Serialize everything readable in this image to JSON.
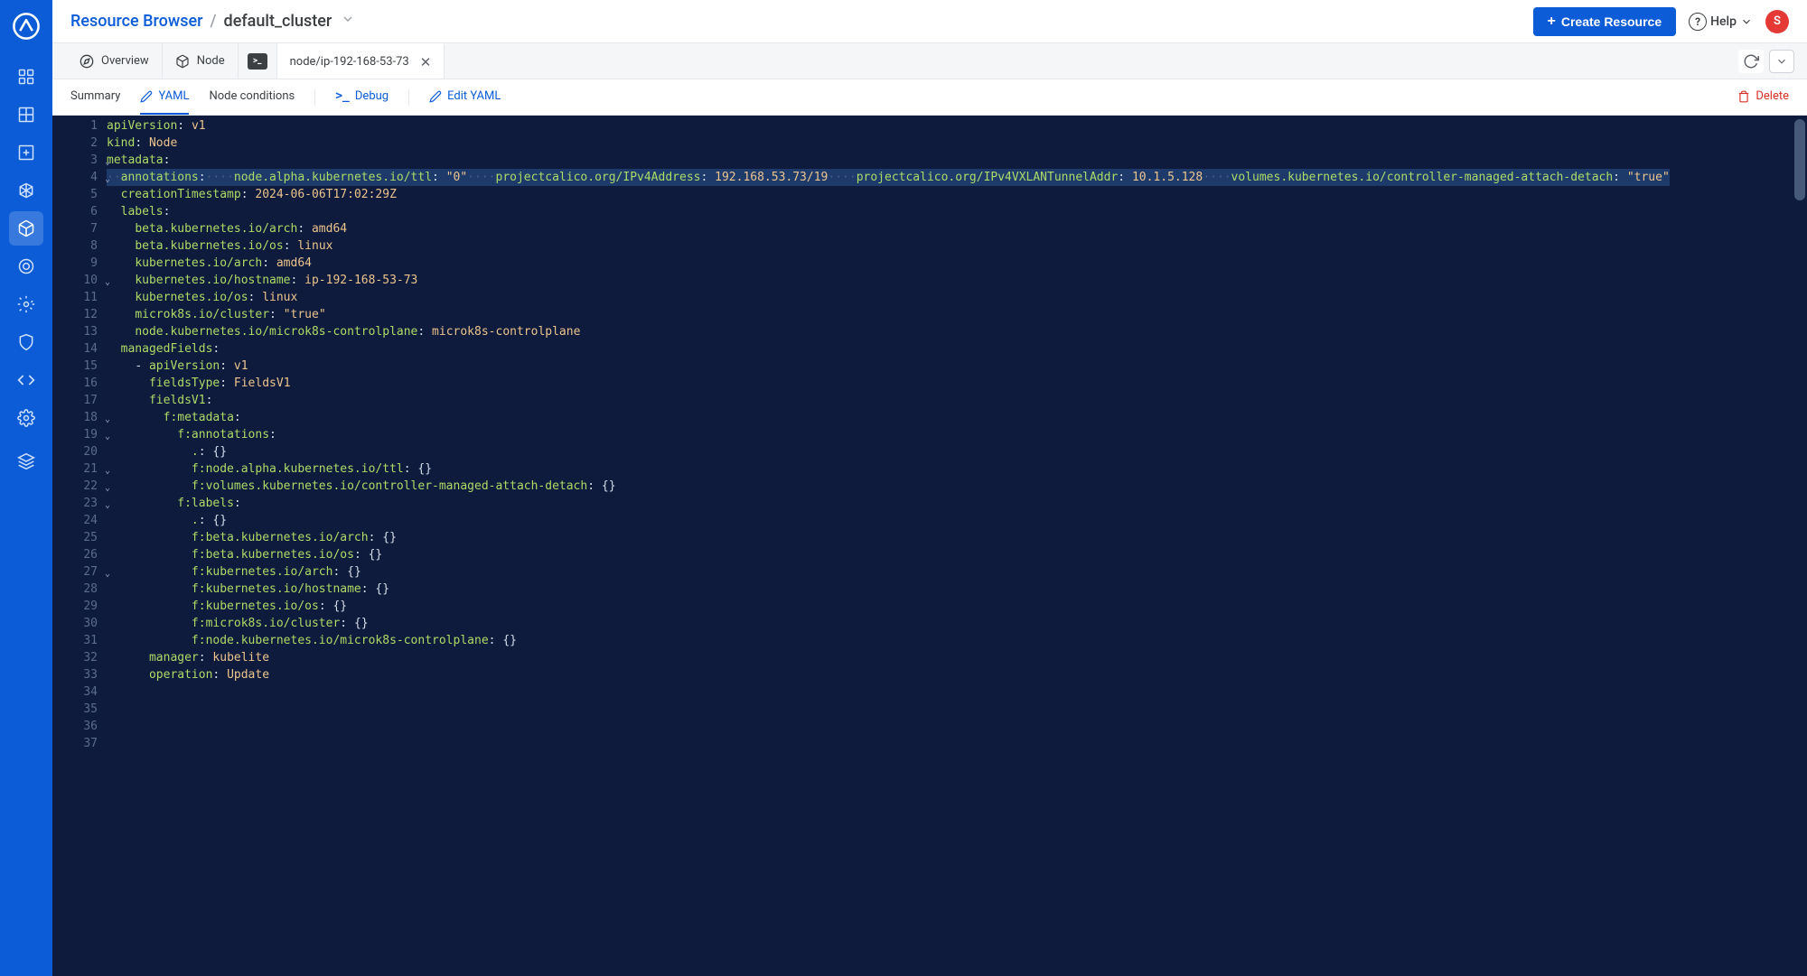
{
  "header": {
    "breadcrumb_root": "Resource Browser",
    "breadcrumb_current": "default_cluster",
    "create_button": "Create Resource",
    "help_label": "Help",
    "avatar_initial": "S"
  },
  "tabs": {
    "overview": "Overview",
    "node": "Node",
    "active": "node/ip-192-168-53-73"
  },
  "subtabs": {
    "summary": "Summary",
    "yaml": "YAML",
    "node_conditions": "Node conditions",
    "debug": "Debug",
    "edit_yaml": "Edit YAML",
    "delete": "Delete"
  },
  "yaml": {
    "lines": [
      {
        "n": 1,
        "fold": "",
        "sel": false,
        "tokens": [
          [
            "key",
            "apiVersion"
          ],
          [
            "punc",
            ": "
          ],
          [
            "val",
            "v1"
          ]
        ]
      },
      {
        "n": 2,
        "fold": "",
        "sel": false,
        "tokens": [
          [
            "key",
            "kind"
          ],
          [
            "punc",
            ": "
          ],
          [
            "val",
            "Node"
          ]
        ]
      },
      {
        "n": 3,
        "fold": "v",
        "sel": false,
        "tokens": [
          [
            "key",
            "metadata"
          ],
          [
            "punc",
            ":"
          ]
        ]
      },
      {
        "n": 4,
        "fold": "v",
        "sel": true,
        "indent": "  ",
        "tokens": [
          [
            "key",
            "annotations"
          ],
          [
            "punc",
            ":"
          ]
        ]
      },
      {
        "n": 5,
        "fold": "",
        "sel": true,
        "indent": "    ",
        "tokens": [
          [
            "key",
            "node.alpha.kubernetes.io/ttl"
          ],
          [
            "punc",
            ": "
          ],
          [
            "str",
            "\"0\""
          ]
        ]
      },
      {
        "n": 6,
        "fold": "",
        "sel": true,
        "indent": "    ",
        "tokens": [
          [
            "key",
            "projectcalico.org/IPv4Address"
          ],
          [
            "punc",
            ": "
          ],
          [
            "val",
            "192.168.53.73/19"
          ]
        ]
      },
      {
        "n": 7,
        "fold": "",
        "sel": true,
        "indent": "    ",
        "tokens": [
          [
            "key",
            "projectcalico.org/IPv4VXLANTunnelAddr"
          ],
          [
            "punc",
            ": "
          ],
          [
            "val",
            "10.1.5.128"
          ]
        ]
      },
      {
        "n": 8,
        "fold": "",
        "sel": true,
        "indent": "    ",
        "tokens": [
          [
            "key",
            "volumes.kubernetes.io/controller-managed-attach-detach"
          ],
          [
            "punc",
            ": "
          ],
          [
            "str",
            "\"true\""
          ]
        ]
      },
      {
        "n": 9,
        "fold": "",
        "sel": false,
        "indent": "  ",
        "tokens": [
          [
            "key",
            "creationTimestamp"
          ],
          [
            "punc",
            ": "
          ],
          [
            "val",
            "2024-06-06T17:02:29Z"
          ]
        ]
      },
      {
        "n": 10,
        "fold": "v",
        "sel": false,
        "indent": "  ",
        "tokens": [
          [
            "key",
            "labels"
          ],
          [
            "punc",
            ":"
          ]
        ]
      },
      {
        "n": 11,
        "fold": "",
        "sel": false,
        "indent": "    ",
        "tokens": [
          [
            "key",
            "beta.kubernetes.io/arch"
          ],
          [
            "punc",
            ": "
          ],
          [
            "val",
            "amd64"
          ]
        ]
      },
      {
        "n": 12,
        "fold": "",
        "sel": false,
        "indent": "    ",
        "tokens": [
          [
            "key",
            "beta.kubernetes.io/os"
          ],
          [
            "punc",
            ": "
          ],
          [
            "val",
            "linux"
          ]
        ]
      },
      {
        "n": 13,
        "fold": "",
        "sel": false,
        "indent": "    ",
        "tokens": [
          [
            "key",
            "kubernetes.io/arch"
          ],
          [
            "punc",
            ": "
          ],
          [
            "val",
            "amd64"
          ]
        ]
      },
      {
        "n": 14,
        "fold": "",
        "sel": false,
        "indent": "    ",
        "tokens": [
          [
            "key",
            "kubernetes.io/hostname"
          ],
          [
            "punc",
            ": "
          ],
          [
            "val",
            "ip-192-168-53-73"
          ]
        ]
      },
      {
        "n": 15,
        "fold": "",
        "sel": false,
        "indent": "    ",
        "tokens": [
          [
            "key",
            "kubernetes.io/os"
          ],
          [
            "punc",
            ": "
          ],
          [
            "val",
            "linux"
          ]
        ]
      },
      {
        "n": 16,
        "fold": "",
        "sel": false,
        "indent": "    ",
        "tokens": [
          [
            "key",
            "microk8s.io/cluster"
          ],
          [
            "punc",
            ": "
          ],
          [
            "str",
            "\"true\""
          ]
        ]
      },
      {
        "n": 17,
        "fold": "",
        "sel": false,
        "indent": "    ",
        "tokens": [
          [
            "key",
            "node.kubernetes.io/microk8s-controlplane"
          ],
          [
            "punc",
            ": "
          ],
          [
            "val",
            "microk8s-controlplane"
          ]
        ]
      },
      {
        "n": 18,
        "fold": "v",
        "sel": false,
        "indent": "  ",
        "tokens": [
          [
            "key",
            "managedFields"
          ],
          [
            "punc",
            ":"
          ]
        ]
      },
      {
        "n": 19,
        "fold": "v",
        "sel": false,
        "indent": "    ",
        "tokens": [
          [
            "punc",
            "- "
          ],
          [
            "key",
            "apiVersion"
          ],
          [
            "punc",
            ": "
          ],
          [
            "val",
            "v1"
          ]
        ]
      },
      {
        "n": 20,
        "fold": "",
        "sel": false,
        "indent": "      ",
        "tokens": [
          [
            "key",
            "fieldsType"
          ],
          [
            "punc",
            ": "
          ],
          [
            "val",
            "FieldsV1"
          ]
        ]
      },
      {
        "n": 21,
        "fold": "v",
        "sel": false,
        "indent": "      ",
        "tokens": [
          [
            "key",
            "fieldsV1"
          ],
          [
            "punc",
            ":"
          ]
        ]
      },
      {
        "n": 22,
        "fold": "v",
        "sel": false,
        "indent": "        ",
        "tokens": [
          [
            "key",
            "f:metadata"
          ],
          [
            "punc",
            ":"
          ]
        ]
      },
      {
        "n": 23,
        "fold": "v",
        "sel": false,
        "indent": "          ",
        "tokens": [
          [
            "key",
            "f:annotations"
          ],
          [
            "punc",
            ":"
          ]
        ]
      },
      {
        "n": 24,
        "fold": "",
        "sel": false,
        "indent": "            ",
        "tokens": [
          [
            "key",
            "."
          ],
          [
            "punc",
            ": "
          ],
          [
            "punc",
            "{}"
          ]
        ]
      },
      {
        "n": 25,
        "fold": "",
        "sel": false,
        "indent": "            ",
        "tokens": [
          [
            "key",
            "f:node.alpha.kubernetes.io/ttl"
          ],
          [
            "punc",
            ": "
          ],
          [
            "punc",
            "{}"
          ]
        ]
      },
      {
        "n": 26,
        "fold": "",
        "sel": false,
        "indent": "            ",
        "tokens": [
          [
            "key",
            "f:volumes.kubernetes.io/controller-managed-attach-detach"
          ],
          [
            "punc",
            ": "
          ],
          [
            "punc",
            "{}"
          ]
        ]
      },
      {
        "n": 27,
        "fold": "v",
        "sel": false,
        "indent": "          ",
        "tokens": [
          [
            "key",
            "f:labels"
          ],
          [
            "punc",
            ":"
          ]
        ]
      },
      {
        "n": 28,
        "fold": "",
        "sel": false,
        "indent": "            ",
        "tokens": [
          [
            "key",
            "."
          ],
          [
            "punc",
            ": "
          ],
          [
            "punc",
            "{}"
          ]
        ]
      },
      {
        "n": 29,
        "fold": "",
        "sel": false,
        "indent": "            ",
        "tokens": [
          [
            "key",
            "f:beta.kubernetes.io/arch"
          ],
          [
            "punc",
            ": "
          ],
          [
            "punc",
            "{}"
          ]
        ]
      },
      {
        "n": 30,
        "fold": "",
        "sel": false,
        "indent": "            ",
        "tokens": [
          [
            "key",
            "f:beta.kubernetes.io/os"
          ],
          [
            "punc",
            ": "
          ],
          [
            "punc",
            "{}"
          ]
        ]
      },
      {
        "n": 31,
        "fold": "",
        "sel": false,
        "indent": "            ",
        "tokens": [
          [
            "key",
            "f:kubernetes.io/arch"
          ],
          [
            "punc",
            ": "
          ],
          [
            "punc",
            "{}"
          ]
        ]
      },
      {
        "n": 32,
        "fold": "",
        "sel": false,
        "indent": "            ",
        "tokens": [
          [
            "key",
            "f:kubernetes.io/hostname"
          ],
          [
            "punc",
            ": "
          ],
          [
            "punc",
            "{}"
          ]
        ]
      },
      {
        "n": 33,
        "fold": "",
        "sel": false,
        "indent": "            ",
        "tokens": [
          [
            "key",
            "f:kubernetes.io/os"
          ],
          [
            "punc",
            ": "
          ],
          [
            "punc",
            "{}"
          ]
        ]
      },
      {
        "n": 34,
        "fold": "",
        "sel": false,
        "indent": "            ",
        "tokens": [
          [
            "key",
            "f:microk8s.io/cluster"
          ],
          [
            "punc",
            ": "
          ],
          [
            "punc",
            "{}"
          ]
        ]
      },
      {
        "n": 35,
        "fold": "",
        "sel": false,
        "indent": "            ",
        "tokens": [
          [
            "key",
            "f:node.kubernetes.io/microk8s-controlplane"
          ],
          [
            "punc",
            ": "
          ],
          [
            "punc",
            "{}"
          ]
        ]
      },
      {
        "n": 36,
        "fold": "",
        "sel": false,
        "indent": "      ",
        "tokens": [
          [
            "key",
            "manager"
          ],
          [
            "punc",
            ": "
          ],
          [
            "val",
            "kubelite"
          ]
        ]
      },
      {
        "n": 37,
        "fold": "",
        "sel": false,
        "indent": "      ",
        "tokens": [
          [
            "key",
            "operation"
          ],
          [
            "punc",
            ": "
          ],
          [
            "val",
            "Update"
          ]
        ]
      }
    ]
  }
}
